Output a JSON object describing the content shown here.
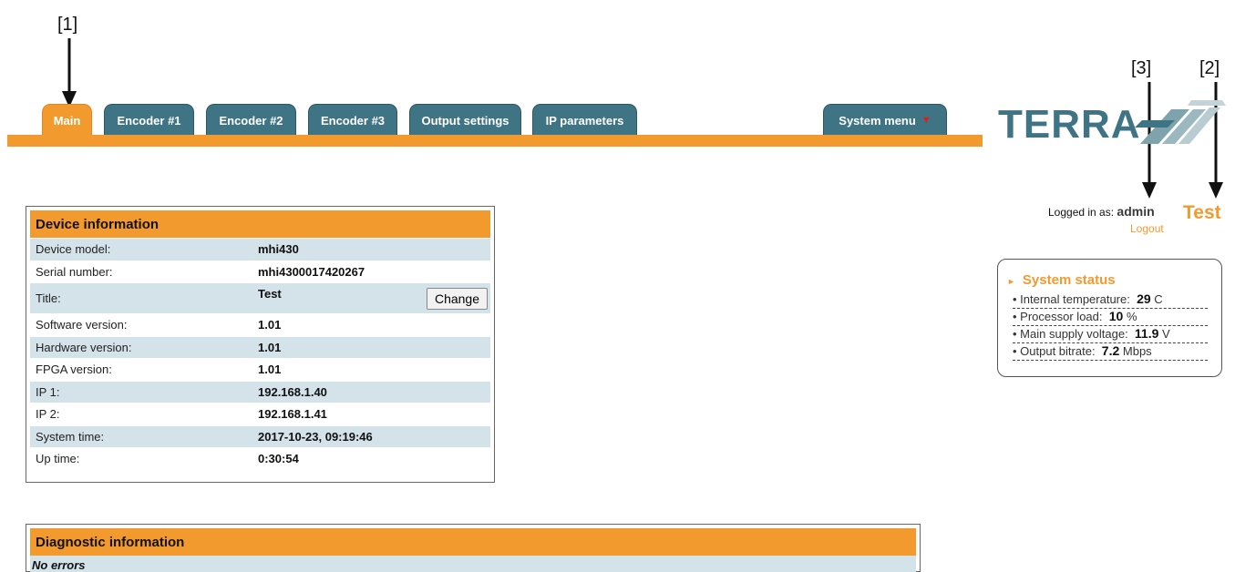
{
  "callouts": [
    "[1]",
    "[2]",
    "[3]"
  ],
  "tabs": [
    {
      "label": "Main",
      "active": true
    },
    {
      "label": "Encoder #1",
      "active": false
    },
    {
      "label": "Encoder #2",
      "active": false
    },
    {
      "label": "Encoder #3",
      "active": false
    },
    {
      "label": "Output settings",
      "active": false
    },
    {
      "label": "IP parameters",
      "active": false
    }
  ],
  "system_menu": {
    "label": "System menu",
    "icon": "caret-down-icon"
  },
  "logo": {
    "text": "TERRA"
  },
  "login": {
    "prefix": "Logged in as:",
    "user": "admin",
    "logout": "Logout",
    "device_name": "Test"
  },
  "status": {
    "title": "System status",
    "rows": [
      {
        "label": "Internal temperature:",
        "value": "29",
        "unit": "C"
      },
      {
        "label": "Processor load:",
        "value": "10",
        "unit": "%"
      },
      {
        "label": "Main supply voltage:",
        "value": "11.9",
        "unit": "V"
      },
      {
        "label": "Output bitrate:",
        "value": "7.2",
        "unit": "Mbps"
      }
    ]
  },
  "device_info": {
    "title": "Device information",
    "change_label": "Change",
    "rows": [
      {
        "key": "Device model:",
        "value": "mhi430"
      },
      {
        "key": "Serial number:",
        "value": "mhi4300017420267"
      },
      {
        "key": "Title:",
        "value": "Test"
      },
      {
        "key": "Software version:",
        "value": "1.01"
      },
      {
        "key": "Hardware version:",
        "value": "1.01"
      },
      {
        "key": "FPGA version:",
        "value": "1.01"
      },
      {
        "key": "IP 1:",
        "value": "192.168.1.40"
      },
      {
        "key": "IP 2:",
        "value": "192.168.1.41"
      },
      {
        "key": "System time:",
        "value": "2017-10-23, 09:19:46"
      },
      {
        "key": "Up time:",
        "value": "0:30:54"
      }
    ]
  },
  "diagnostic": {
    "title": "Diagnostic information",
    "message": "No errors"
  },
  "colors": {
    "accent": "#f29a2e",
    "tab": "#3f7484",
    "row_alt": "#d4e3ea"
  }
}
